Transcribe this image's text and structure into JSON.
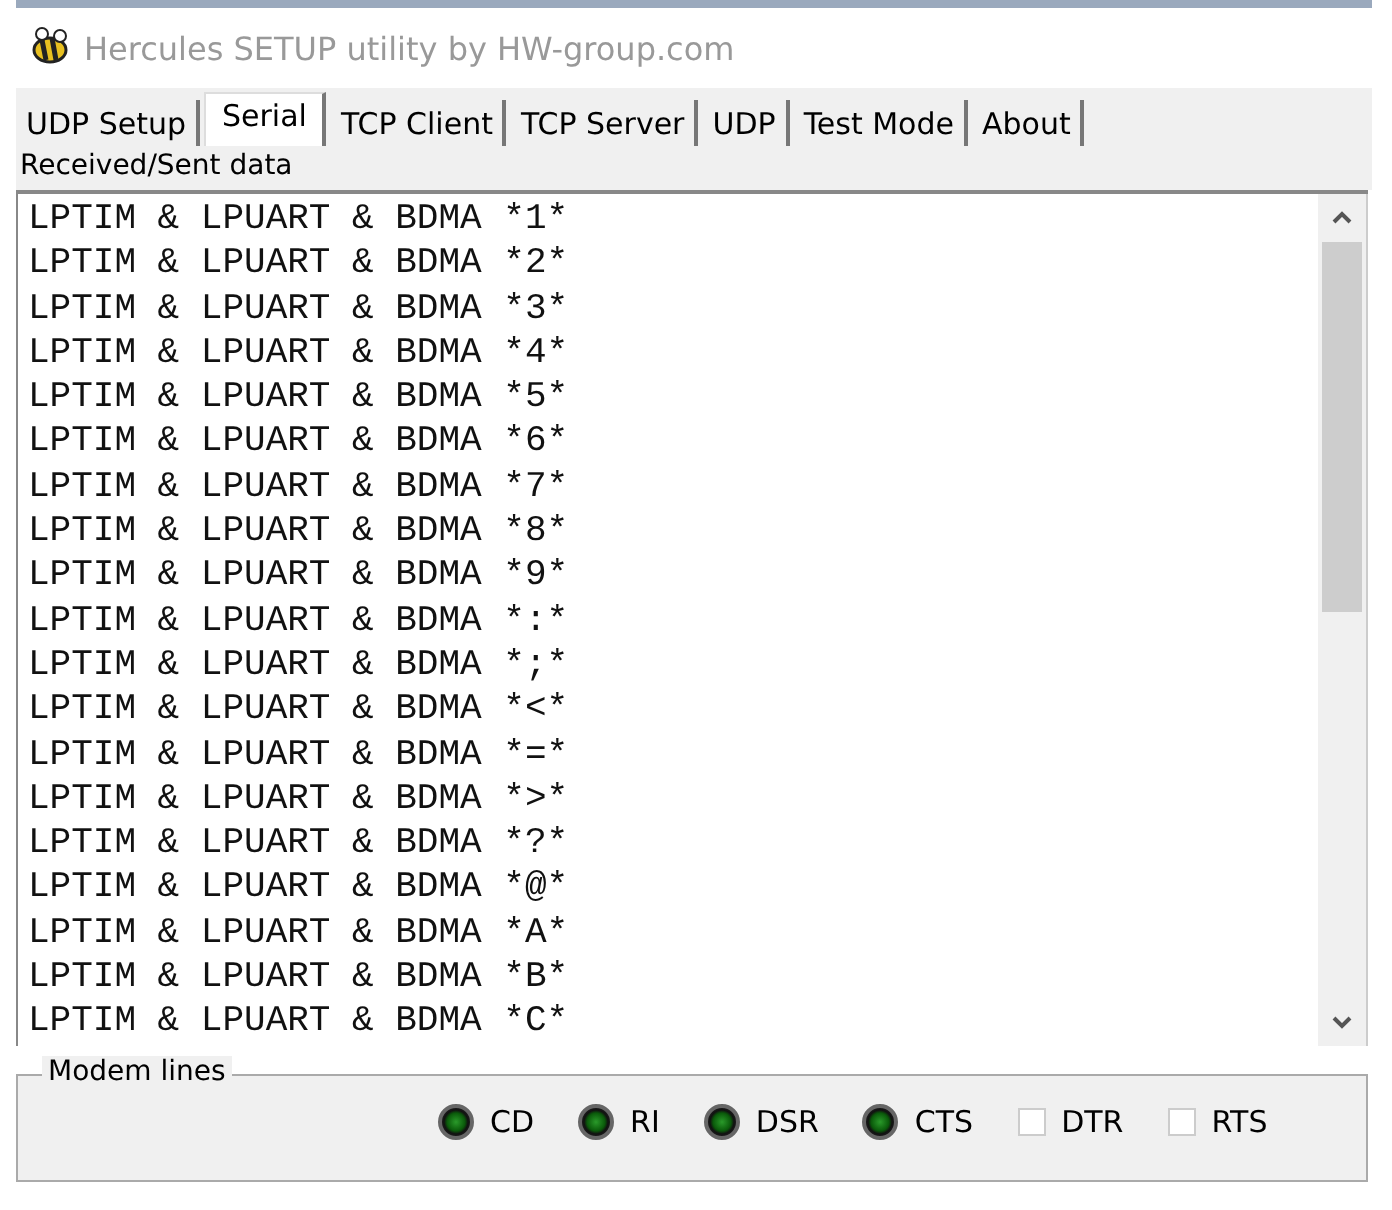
{
  "window": {
    "title": "Hercules SETUP utility by HW-group.com"
  },
  "tabs": [
    {
      "label": "UDP Setup",
      "selected": false
    },
    {
      "label": "Serial",
      "selected": true
    },
    {
      "label": "TCP Client",
      "selected": false
    },
    {
      "label": "TCP Server",
      "selected": false
    },
    {
      "label": "UDP",
      "selected": false
    },
    {
      "label": "Test Mode",
      "selected": false
    },
    {
      "label": "About",
      "selected": false
    }
  ],
  "data_panel": {
    "label": "Received/Sent data",
    "lines": [
      "LPTIM & LPUART & BDMA *1*",
      "LPTIM & LPUART & BDMA *2*",
      "LPTIM & LPUART & BDMA *3*",
      "LPTIM & LPUART & BDMA *4*",
      "LPTIM & LPUART & BDMA *5*",
      "LPTIM & LPUART & BDMA *6*",
      "LPTIM & LPUART & BDMA *7*",
      "LPTIM & LPUART & BDMA *8*",
      "LPTIM & LPUART & BDMA *9*",
      "LPTIM & LPUART & BDMA *:*",
      "LPTIM & LPUART & BDMA *;*",
      "LPTIM & LPUART & BDMA *<*",
      "LPTIM & LPUART & BDMA *=*",
      "LPTIM & LPUART & BDMA *>*",
      "LPTIM & LPUART & BDMA *?*",
      "LPTIM & LPUART & BDMA *@*",
      "LPTIM & LPUART & BDMA *A*",
      "LPTIM & LPUART & BDMA *B*",
      "LPTIM & LPUART & BDMA *C*"
    ]
  },
  "modem_lines": {
    "label": "Modem lines",
    "signals": [
      {
        "kind": "led",
        "label": "CD"
      },
      {
        "kind": "led",
        "label": "RI"
      },
      {
        "kind": "led",
        "label": "DSR"
      },
      {
        "kind": "led",
        "label": "CTS"
      },
      {
        "kind": "checkbox",
        "label": "DTR",
        "checked": false
      },
      {
        "kind": "checkbox",
        "label": "RTS",
        "checked": false
      }
    ]
  }
}
